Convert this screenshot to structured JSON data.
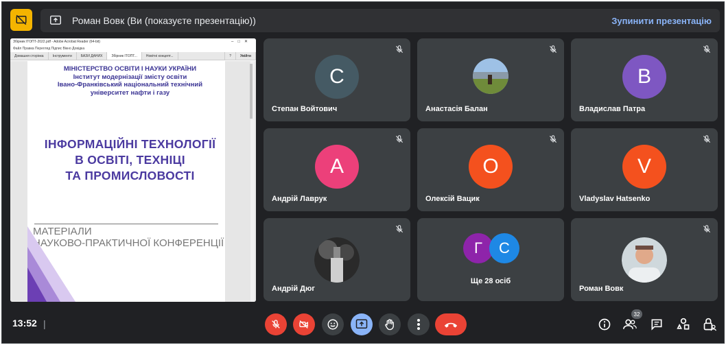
{
  "top_bar": {
    "presenter_title": "Роман Вовк (Ви (показуєте презентацію))",
    "stop_label": "Зупинити презентацію",
    "accent": "#f4b400"
  },
  "shared_screen": {
    "window_title": "Збірник ITOПТ-2022.pdf - Adobe Acrobat Reader (64-bit)",
    "menu": "Файл  Правка  Перегляд  Підпис  Вікно  Довідка",
    "tabs": [
      "Домашня сторінка",
      "Інструменти",
      "БАЗИ ДАНИХ",
      "Збірник ITOПТ...",
      "Новітні концепт...",
      "?",
      "Увійти"
    ],
    "doc": {
      "ministry_lines": [
        "МІНІСТЕРСТВО ОСВІТИ І НАУКИ УКРАЇНИ",
        "Інститут модернізації змісту освіти",
        "Івано-Франківський національний технічний",
        "університет нафти і газу"
      ],
      "title_lines": [
        "ІНФОРМАЦІЙНІ ТЕХНОЛОГІЇ",
        "В ОСВІТІ, ТЕХНІЦІ",
        "ТА ПРОМИСЛОВОСТІ"
      ],
      "materials_lines": [
        "МАТЕРІАЛИ",
        "НАУКОВО-ПРАКТИЧНОЇ КОНФЕРЕНЦІЇ"
      ]
    }
  },
  "participants": [
    {
      "name": "Степан Войтович",
      "initial": "С",
      "color": "#455a64",
      "muted": true
    },
    {
      "name": "Анастасія Балан",
      "initial": "",
      "color": "",
      "muted": true,
      "photo": true
    },
    {
      "name": "Владислав Патра",
      "initial": "В",
      "color": "#7e57c2",
      "muted": true
    },
    {
      "name": "Андрій Лаврук",
      "initial": "А",
      "color": "#ec407a",
      "muted": true
    },
    {
      "name": "Олексій Вацик",
      "initial": "О",
      "color": "#f4511e",
      "muted": true
    },
    {
      "name": "Vladyslav Hatsenko",
      "initial": "V",
      "color": "#f4511e",
      "muted": true
    },
    {
      "name": "Андрій Дюг",
      "initial": "",
      "color": "",
      "muted": true,
      "photo": true
    },
    {
      "name": "Роман Вовк",
      "initial": "",
      "color": "",
      "muted": true,
      "photo": true
    }
  ],
  "others": {
    "avatars": [
      {
        "initial": "Г",
        "color": "#8e24aa"
      },
      {
        "initial": "С",
        "color": "#1e88e5"
      }
    ],
    "label": "Ще 28 осіб"
  },
  "bottom_bar": {
    "time": "13:52",
    "participants_count": "32",
    "mic_state": "off",
    "camera_state": "off",
    "danger_color": "#ea4335",
    "present_color": "#8ab4f8"
  }
}
